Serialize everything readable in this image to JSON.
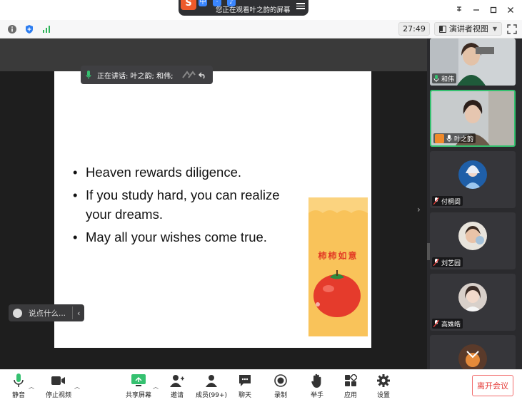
{
  "share_bar": {
    "text": "您正在观看叶之韵的屏幕",
    "logo": "S",
    "icon_glyphs": [
      "中",
      "·",
      "♪"
    ]
  },
  "toolstrip": {
    "timer": "27:49",
    "view_mode": "演讲者视图"
  },
  "speaking": {
    "label": "正在讲话: 叶之韵; 和伟;"
  },
  "slide": {
    "bullets": [
      "Heaven rewards diligence.",
      "If you study hard,  you can realize your dreams.",
      "May all your wishes come true."
    ],
    "card_title": "柿柿如意"
  },
  "chat": {
    "placeholder": "说点什么..."
  },
  "gallery": [
    {
      "name": "和伟",
      "has_video": true,
      "muted": false
    },
    {
      "name": "叶之韵",
      "has_video": true,
      "muted": false,
      "active": true
    },
    {
      "name": "付桐阆",
      "has_video": false,
      "muted": true
    },
    {
      "name": "刘艺园",
      "has_video": false,
      "muted": true
    },
    {
      "name": "高姝皓",
      "has_video": false,
      "muted": true
    }
  ],
  "toolbar": {
    "mute": "静音",
    "stop_video": "停止视频",
    "share": "共享屏幕",
    "invite": "邀请",
    "members": "成员(99+)",
    "chat": "聊天",
    "record": "录制",
    "raise_hand": "举手",
    "apps": "应用",
    "settings": "设置",
    "leave": "离开会议"
  },
  "colors": {
    "accent_green": "#35c170",
    "leave_red": "#e53935",
    "slide_card": "#f9c35a"
  }
}
